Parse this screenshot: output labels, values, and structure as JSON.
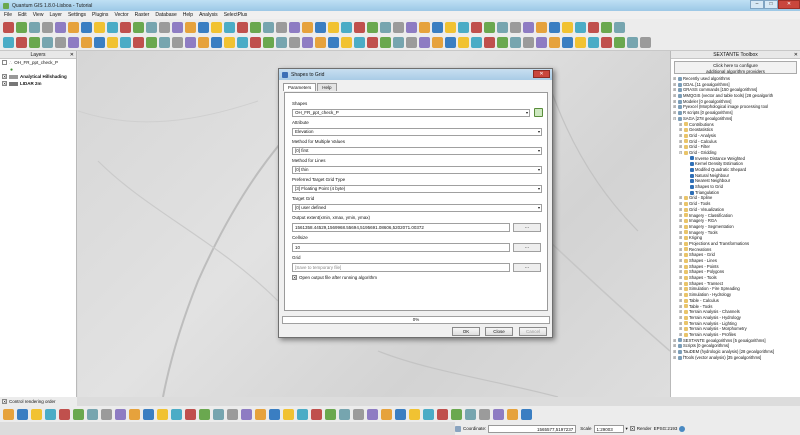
{
  "window": {
    "title": "Quantum GIS 1.8.0-Lisboa - Tutorial"
  },
  "menu": [
    "File",
    "Edit",
    "View",
    "Layer",
    "Settings",
    "Plugins",
    "Vector",
    "Raster",
    "Database",
    "Help",
    "Analysis",
    "SelectPlus"
  ],
  "layers_panel": {
    "title": "Layers",
    "items": [
      {
        "label": "OH_FR_ppt_check_P",
        "checked": false
      },
      {
        "label": "Analytical Hillshading",
        "checked": true
      },
      {
        "label": "LIDAR 2m",
        "checked": true
      }
    ],
    "control_rendering_order": "Control rendering order"
  },
  "toolbox": {
    "title": "SEXTANTE Toolbox",
    "config_button": "Click here to configure\nadditional algorithm providers",
    "tree": [
      {
        "label": "Recently used algorithms",
        "level": 0,
        "exp": "+"
      },
      {
        "label": "GDAL [11 geoalgorithms]",
        "level": 0,
        "exp": "+"
      },
      {
        "label": "GRASS commands [150 geoalgorithms]",
        "level": 0,
        "exp": "+"
      },
      {
        "label": "MMQGIS (vector and table tools) [28 geoalgorith",
        "level": 0,
        "exp": "+"
      },
      {
        "label": "Modeler [0 geoalgorithms]",
        "level": 0,
        "exp": "+"
      },
      {
        "label": "Pyexcel (Morphological image processing tool",
        "level": 0,
        "exp": "+"
      },
      {
        "label": "R scripts [0 geoalgorithms]",
        "level": 0,
        "exp": "+"
      },
      {
        "label": "SAGA [278 geoalgorithms]",
        "level": 0,
        "exp": "-"
      },
      {
        "label": "Contributions",
        "level": 1,
        "exp": "+"
      },
      {
        "label": "Geostatistics",
        "level": 1,
        "exp": "+"
      },
      {
        "label": "Grid - Analysis",
        "level": 1,
        "exp": "+"
      },
      {
        "label": "Grid - Calculus",
        "level": 1,
        "exp": "+"
      },
      {
        "label": "Grid - Filter",
        "level": 1,
        "exp": "+"
      },
      {
        "label": "Grid - Gridding",
        "level": 1,
        "exp": "-"
      },
      {
        "label": "Inverse Distance Weighted",
        "level": 2,
        "exp": ""
      },
      {
        "label": "Kernel Density Estimation",
        "level": 2,
        "exp": ""
      },
      {
        "label": "Modifed Quadratic Shepard",
        "level": 2,
        "exp": ""
      },
      {
        "label": "Natural Neighbour",
        "level": 2,
        "exp": ""
      },
      {
        "label": "Nearest Neighbour",
        "level": 2,
        "exp": ""
      },
      {
        "label": "Shapes to Grid",
        "level": 2,
        "exp": ""
      },
      {
        "label": "Triangulation",
        "level": 2,
        "exp": ""
      },
      {
        "label": "Grid - Spline",
        "level": 1,
        "exp": "+"
      },
      {
        "label": "Grid - Tools",
        "level": 1,
        "exp": "+"
      },
      {
        "label": "Grid - Visualization",
        "level": 1,
        "exp": "+"
      },
      {
        "label": "Imagery - Classification",
        "level": 1,
        "exp": "+"
      },
      {
        "label": "Imagery - RGA",
        "level": 1,
        "exp": "+"
      },
      {
        "label": "Imagery - Segmentation",
        "level": 1,
        "exp": "+"
      },
      {
        "label": "Imagery - Tools",
        "level": 1,
        "exp": "+"
      },
      {
        "label": "Kriging",
        "level": 1,
        "exp": "+"
      },
      {
        "label": "Projections and Transformations",
        "level": 1,
        "exp": "+"
      },
      {
        "label": "Recreations",
        "level": 1,
        "exp": "+"
      },
      {
        "label": "Shapes - Grid",
        "level": 1,
        "exp": "+"
      },
      {
        "label": "Shapes - Lines",
        "level": 1,
        "exp": "+"
      },
      {
        "label": "Shapes - Points",
        "level": 1,
        "exp": "+"
      },
      {
        "label": "Shapes - Polygons",
        "level": 1,
        "exp": "+"
      },
      {
        "label": "Shapes - Tools",
        "level": 1,
        "exp": "+"
      },
      {
        "label": "Shapes - Transect",
        "level": 1,
        "exp": "+"
      },
      {
        "label": "Simulation - Fire Spreading",
        "level": 1,
        "exp": "+"
      },
      {
        "label": "Simulation - Hydrology",
        "level": 1,
        "exp": "+"
      },
      {
        "label": "Table - Calculus",
        "level": 1,
        "exp": "+"
      },
      {
        "label": "Table - Tools",
        "level": 1,
        "exp": "+"
      },
      {
        "label": "Terrain Analysis - Channels",
        "level": 1,
        "exp": "+"
      },
      {
        "label": "Terrain Analysis - Hydrology",
        "level": 1,
        "exp": "+"
      },
      {
        "label": "Terrain Analysis - Lighting",
        "level": 1,
        "exp": "+"
      },
      {
        "label": "Terrain Analysis - Morphometry",
        "level": 1,
        "exp": "+"
      },
      {
        "label": "Terrain Analysis - Profiles",
        "level": 1,
        "exp": "+"
      },
      {
        "label": "SEXTANTE geoalgorithms [5 geoalgorithms]",
        "level": 0,
        "exp": "+"
      },
      {
        "label": "Scripts [0 geoalgorithms]",
        "level": 0,
        "exp": "+"
      },
      {
        "label": "TauDEM (hydrologic analysis) [28 geoalgorithms]",
        "level": 0,
        "exp": "+"
      },
      {
        "label": "fTools (vector analysis) [35 geoalgorithms]",
        "level": 0,
        "exp": "+"
      }
    ]
  },
  "dialog": {
    "title": "Shapes to Grid",
    "tabs": [
      "Parameters",
      "Help"
    ],
    "fields": {
      "shapes_label": "Shapes",
      "shapes_value": "OH_FR_ppt_check_P",
      "attribute_label": "Attribute",
      "attribute_value": "Elevation",
      "multiple_label": "Method for Multiple Values",
      "multiple_value": "[0] first",
      "lines_label": "Method for Lines",
      "lines_value": "[0] thin",
      "gridtype_label": "Preferred Target Grid Type",
      "gridtype_value": "[3] Floating Point (4 byte)",
      "target_label": "Target Grid",
      "target_value": "[0] user defined",
      "extent_label": "Output extent(xmin, xmax, ymin, ymax)",
      "extent_value": "1561358.44529,1569968.55694,5195691.08606,5202071.00372",
      "cellsize_label": "Cellsize",
      "cellsize_value": "10",
      "grid_label": "Grid",
      "grid_placeholder": "[Save to temporary file]",
      "open_output_label": "Open output file after running algorithm",
      "dots": "..."
    },
    "progress": "0%",
    "buttons": {
      "ok": "OK",
      "close": "Close",
      "cancel": "Cancel"
    }
  },
  "statusbar": {
    "coordinate_label": "Coordinate:",
    "coordinate_value": "1565577,5197237",
    "scale_label": "Scale",
    "scale_value": "1:29003",
    "render_label": "Render",
    "crs_label": "EPSG:2193"
  }
}
